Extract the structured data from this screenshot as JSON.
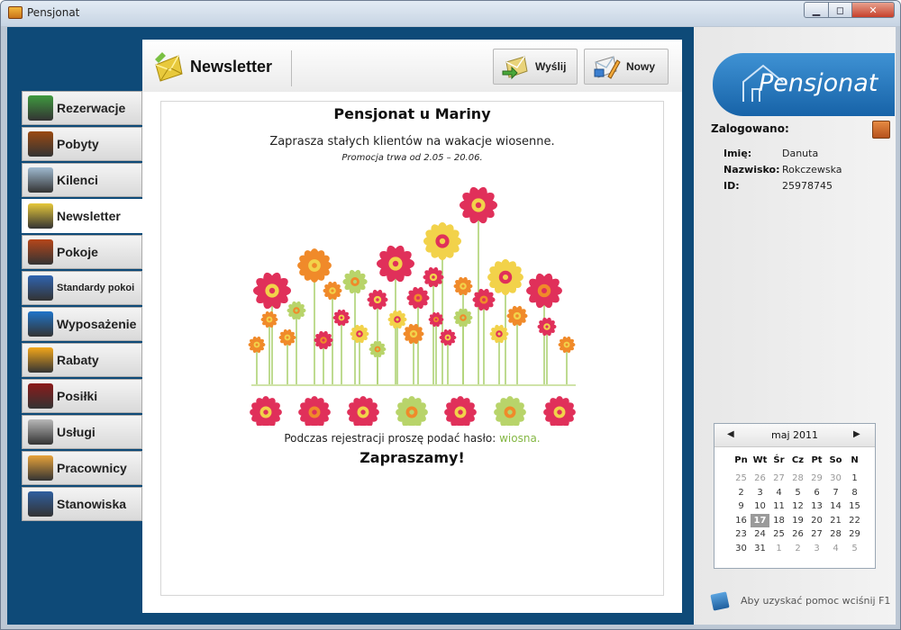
{
  "window": {
    "title": "Pensjonat",
    "min_glyph": "▁",
    "max_glyph": "◻",
    "close_glyph": "✕"
  },
  "nav": [
    {
      "label": "Rezerwacje",
      "icon": "calendar-icon",
      "color": "#3f9a3f"
    },
    {
      "label": "Pobyty",
      "icon": "suitcase-icon",
      "color": "#9a4a12"
    },
    {
      "label": "Kilenci",
      "icon": "person-icon",
      "color": "#9fbad0"
    },
    {
      "label": "Newsletter",
      "icon": "envelope-icon",
      "color": "#e6c83a",
      "active": true
    },
    {
      "label": "Pokoje",
      "icon": "bed-icon",
      "color": "#b6461a"
    },
    {
      "label": "Standardy pokoi",
      "icon": "room-standard-icon",
      "color": "#2f64b1"
    },
    {
      "label": "Wyposażenie",
      "icon": "armchair-icon",
      "color": "#1f74c9"
    },
    {
      "label": "Rabaty",
      "icon": "star-icon",
      "color": "#f3a71a"
    },
    {
      "label": "Posiłki",
      "icon": "pot-icon",
      "color": "#8b1a1a"
    },
    {
      "label": "Usługi",
      "icon": "clock-icon",
      "color": "#b8b8b8"
    },
    {
      "label": "Pracownicy",
      "icon": "workers-icon",
      "color": "#e8a33a"
    },
    {
      "label": "Stanowiska",
      "icon": "briefcase-icon",
      "color": "#2f5f9f"
    }
  ],
  "header": {
    "title": "Newsletter",
    "send_label": "Wyślij",
    "new_label": "Nowy"
  },
  "newsletter": {
    "title": "Pensjonat u Mariny",
    "invite": "Zaprasza stałych klientów na wakacje wiosenne.",
    "promo": "Promocja trwa od 2.05 – 20.06.",
    "hint_text": "Podczas rejestracji proszę podać hasło: ",
    "password": "wiosna.",
    "closing": "Zapraszamy!"
  },
  "logo": {
    "text": "Pensjonat"
  },
  "user": {
    "logged_label": "Zalogowano:",
    "first_name_label": "Imię:",
    "first_name": "Danuta",
    "last_name_label": "Nazwisko:",
    "last_name": "Rokczewska",
    "id_label": "ID:",
    "id": "25978745"
  },
  "calendar": {
    "title": "maj 2011",
    "prev": "◀",
    "next": "▶",
    "dows": [
      "Pn",
      "Wt",
      "Śr",
      "Cz",
      "Pt",
      "So",
      "N"
    ],
    "weeks": [
      [
        "25",
        "26",
        "27",
        "28",
        "29",
        "30",
        "1"
      ],
      [
        "2",
        "3",
        "4",
        "5",
        "6",
        "7",
        "8"
      ],
      [
        "9",
        "10",
        "11",
        "12",
        "13",
        "14",
        "15"
      ],
      [
        "16",
        "17",
        "18",
        "19",
        "20",
        "21",
        "22"
      ],
      [
        "23",
        "24",
        "25",
        "26",
        "27",
        "28",
        "29"
      ],
      [
        "30",
        "31",
        "1",
        "2",
        "3",
        "4",
        "5"
      ]
    ],
    "today": "17"
  },
  "help": {
    "text": "Aby uzyskać pomoc wciśnij F1"
  },
  "colors": {
    "accent": "#0e4a78",
    "password": "#86b846",
    "flower_red": "#e0305a",
    "flower_orange": "#f08a2a",
    "flower_yellow": "#f2d24a",
    "flower_green": "#b8d46a"
  }
}
